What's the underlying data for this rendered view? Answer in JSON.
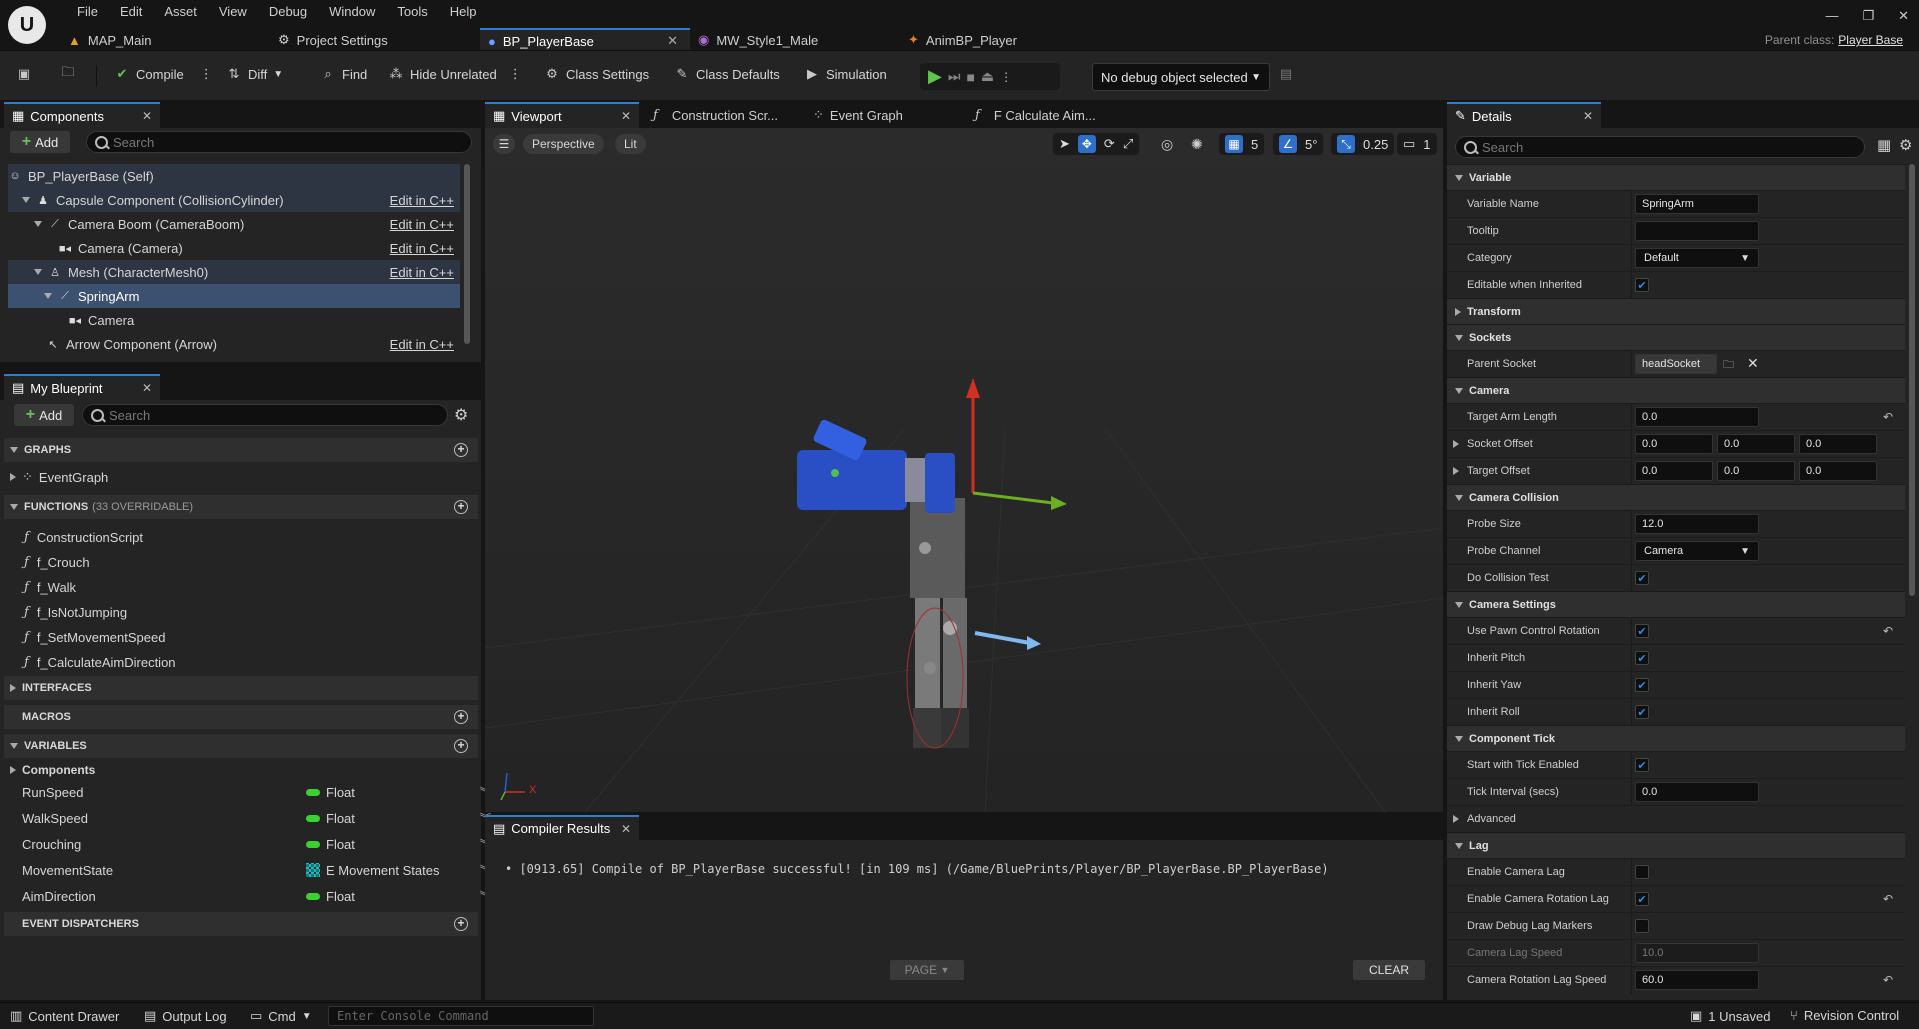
{
  "menu": [
    "File",
    "Edit",
    "Asset",
    "View",
    "Debug",
    "Window",
    "Tools",
    "Help"
  ],
  "doc_tabs": [
    {
      "label": "MAP_Main",
      "icon": "map-icon"
    },
    {
      "label": "Project Settings",
      "icon": "gear-icon"
    },
    {
      "label": "BP_PlayerBase",
      "icon": "blueprint-icon",
      "active": true
    },
    {
      "label": "MW_Style1_Male",
      "icon": "material-icon"
    },
    {
      "label": "AnimBP_Player",
      "icon": "anim-icon"
    }
  ],
  "parent_class": {
    "label": "Parent class:",
    "value": "Player Base"
  },
  "toolbar": {
    "compile": "Compile",
    "diff": "Diff",
    "find": "Find",
    "hide_unrelated": "Hide Unrelated",
    "class_settings": "Class Settings",
    "class_defaults": "Class Defaults",
    "simulation": "Simulation",
    "debug_object": "No debug object selected"
  },
  "components": {
    "tab": "Components",
    "add": "Add",
    "search_placeholder": "Search",
    "rows": [
      {
        "label": "BP_PlayerBase (Self)",
        "edit": ""
      },
      {
        "label": "Capsule Component (CollisionCylinder)",
        "edit": "Edit in C++"
      },
      {
        "label": "Camera Boom (CameraBoom)",
        "edit": "Edit in C++"
      },
      {
        "label": "Camera (Camera)",
        "edit": "Edit in C++"
      },
      {
        "label": "Mesh (CharacterMesh0)",
        "edit": "Edit in C++"
      },
      {
        "label": "SpringArm",
        "edit": ""
      },
      {
        "label": "Camera",
        "edit": ""
      },
      {
        "label": "Arrow Component (Arrow)",
        "edit": "Edit in C++"
      }
    ]
  },
  "my_blueprint": {
    "tab": "My Blueprint",
    "add": "Add",
    "search_placeholder": "Search",
    "graphs": "GRAPHS",
    "graph_items": [
      "EventGraph"
    ],
    "functions": "FUNCTIONS",
    "functions_sub": "(33 OVERRIDABLE)",
    "function_items": [
      "ConstructionScript",
      "f_Crouch",
      "f_Walk",
      "f_IsNotJumping",
      "f_SetMovementSpeed",
      "f_CalculateAimDirection"
    ],
    "interfaces": "INTERFACES",
    "macros": "MACROS",
    "variables": "VARIABLES",
    "variables_group": "Components",
    "variable_items": [
      {
        "name": "RunSpeed",
        "type": "Float"
      },
      {
        "name": "WalkSpeed",
        "type": "Float"
      },
      {
        "name": "Crouching",
        "type": "Float"
      },
      {
        "name": "MovementState",
        "type": "E Movement States"
      },
      {
        "name": "AimDirection",
        "type": "Float"
      }
    ],
    "event_dispatchers": "EVENT DISPATCHERS"
  },
  "editor_tabs": [
    "Viewport",
    "Construction Scr...",
    "Event Graph",
    "F Calculate Aim..."
  ],
  "viewport": {
    "perspective": "Perspective",
    "lit": "Lit",
    "grid_snap": "5",
    "rot_snap": "5°",
    "scale_snap": "0.25",
    "cam_speed": "1",
    "axis_x": "X"
  },
  "compiler": {
    "tab": "Compiler Results",
    "log": "[0913.65] Compile of BP_PlayerBase successful! [in 109 ms] (/Game/BluePrints/Player/BP_PlayerBase.BP_PlayerBase)",
    "page": "PAGE",
    "clear": "CLEAR"
  },
  "details": {
    "tab": "Details",
    "search_placeholder": "Search",
    "variable": "Variable",
    "variable_name_label": "Variable Name",
    "variable_name": "SpringArm",
    "tooltip_label": "Tooltip",
    "category_label": "Category",
    "category": "Default",
    "editable_label": "Editable when Inherited",
    "transform": "Transform",
    "sockets": "Sockets",
    "parent_socket_label": "Parent Socket",
    "parent_socket": "headSocket",
    "camera": "Camera",
    "target_arm_label": "Target Arm Length",
    "target_arm": "0.0",
    "socket_offset_label": "Socket Offset",
    "socket_offset": [
      "0.0",
      "0.0",
      "0.0"
    ],
    "target_offset_label": "Target Offset",
    "target_offset": [
      "0.0",
      "0.0",
      "0.0"
    ],
    "camera_collision": "Camera Collision",
    "probe_size_label": "Probe Size",
    "probe_size": "12.0",
    "probe_channel_label": "Probe Channel",
    "probe_channel": "Camera",
    "do_collision_label": "Do Collision Test",
    "camera_settings": "Camera Settings",
    "use_pawn_label": "Use Pawn Control Rotation",
    "inherit_pitch_label": "Inherit Pitch",
    "inherit_yaw_label": "Inherit Yaw",
    "inherit_roll_label": "Inherit Roll",
    "component_tick": "Component Tick",
    "start_tick_label": "Start with Tick Enabled",
    "tick_interval_label": "Tick Interval (secs)",
    "tick_interval": "0.0",
    "advanced": "Advanced",
    "lag": "Lag",
    "enable_lag_label": "Enable Camera Lag",
    "enable_rot_lag_label": "Enable Camera Rotation Lag",
    "draw_debug_label": "Draw Debug Lag Markers",
    "lag_speed_label": "Camera Lag Speed",
    "lag_speed": "10.0",
    "rot_lag_speed_label": "Camera Rotation Lag Speed",
    "rot_lag_speed": "60.0"
  },
  "statusbar": {
    "content_drawer": "Content Drawer",
    "output_log": "Output Log",
    "cmd": "Cmd",
    "console_placeholder": "Enter Console Command",
    "unsaved": "1 Unsaved",
    "revision": "Revision Control"
  },
  "colors": {
    "accent": "#2d7dd2",
    "float_pin": "#3bd12e",
    "enum_pin": "#27b4b4"
  }
}
